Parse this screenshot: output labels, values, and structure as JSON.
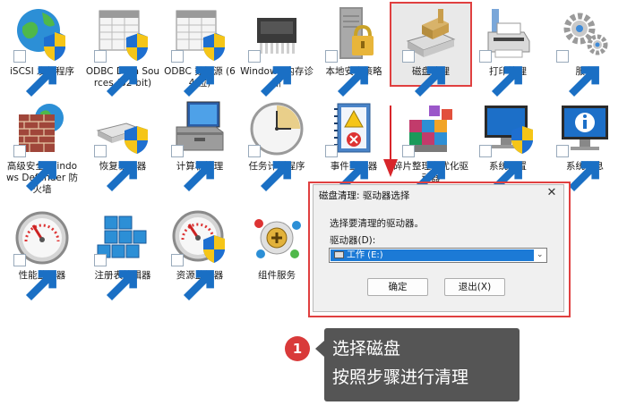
{
  "tiles": [
    {
      "name": "iscsi-initiator",
      "label": "iSCSI 发起程序",
      "icon": "globe-shield-icon"
    },
    {
      "name": "odbc-32",
      "label": "ODBC Data Sources (32-bit)",
      "icon": "database-table-icon"
    },
    {
      "name": "odbc-64",
      "label": "ODBC 数据源 (64 位)",
      "icon": "database-table-icon"
    },
    {
      "name": "memory-diagnostic",
      "label": "Windows 内存诊断",
      "icon": "memory-chip-icon"
    },
    {
      "name": "local-security-policy",
      "label": "本地安全策略",
      "icon": "server-lock-icon"
    },
    {
      "name": "disk-cleanup",
      "label": "磁盘清理",
      "icon": "disk-cleanup-icon"
    },
    {
      "name": "print-management",
      "label": "打印管理",
      "icon": "printer-icon"
    },
    {
      "name": "services",
      "label": "服务",
      "icon": "gears-icon"
    },
    {
      "name": "defender-firewall",
      "label": "高级安全 Windows Defender 防火墙",
      "icon": "firewall-icon"
    },
    {
      "name": "recovery-drive",
      "label": "恢复驱动器",
      "icon": "drive-shield-icon"
    },
    {
      "name": "computer-management",
      "label": "计算机管理",
      "icon": "computer-toolbox-icon"
    },
    {
      "name": "task-scheduler",
      "label": "任务计划程序",
      "icon": "clock-icon"
    },
    {
      "name": "event-viewer",
      "label": "事件查看器",
      "icon": "event-book-icon"
    },
    {
      "name": "defrag",
      "label": "碎片整理和优化驱动器",
      "icon": "defrag-blocks-icon"
    },
    {
      "name": "system-configuration",
      "label": "系统配置",
      "icon": "monitor-shield-icon"
    },
    {
      "name": "system-information",
      "label": "系统信息",
      "icon": "monitor-info-icon"
    },
    {
      "name": "performance-monitor",
      "label": "性能监视器",
      "icon": "gauge-icon"
    },
    {
      "name": "registry-editor",
      "label": "注册表编辑器",
      "icon": "registry-cubes-icon"
    },
    {
      "name": "resource-monitor",
      "label": "资源监视器",
      "icon": "gauge-shield-icon"
    },
    {
      "name": "component-services",
      "label": "组件服务",
      "icon": "component-services-icon"
    }
  ],
  "dialog": {
    "title": "磁盘清理: 驱动器选择",
    "close": "✕",
    "prompt": "选择要清理的驱动器。",
    "drive_label": "驱动器(D):",
    "drive_value": "工作 (E:)",
    "ok_label": "确定",
    "exit_label": "退出(X)"
  },
  "callout": {
    "step": "1",
    "line1": "选择磁盘",
    "line2": "按照步骤进行清理"
  },
  "colors": {
    "highlight": "#e04040",
    "selection": "#1c7ad6",
    "callout_bg": "#555555"
  }
}
